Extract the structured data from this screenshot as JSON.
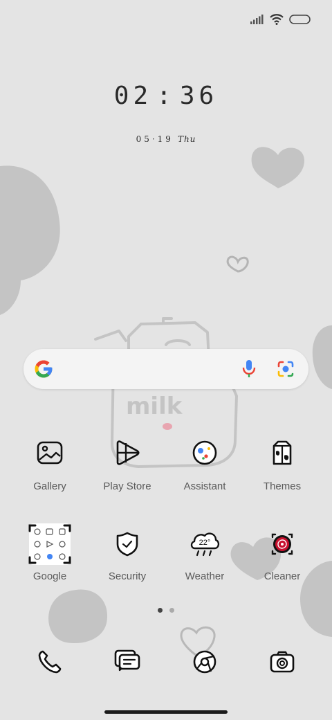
{
  "status_bar": {
    "icons": [
      "signal-icon",
      "wifi-icon",
      "battery-icon"
    ]
  },
  "clock": {
    "hour": "02",
    "minute": "36"
  },
  "date": {
    "month_day": "05·19",
    "weekday": "Thu"
  },
  "wallpaper": {
    "text": "milk"
  },
  "search": {
    "icons": [
      "google-g-icon",
      "microphone-icon",
      "lens-camera-icon"
    ]
  },
  "apps": [
    {
      "label": "Gallery",
      "icon": "gallery-icon"
    },
    {
      "label": "Play Store",
      "icon": "play-store-icon"
    },
    {
      "label": "Assistant",
      "icon": "assistant-icon"
    },
    {
      "label": "Themes",
      "icon": "themes-icon"
    },
    {
      "label": "Google",
      "icon": "google-folder-icon"
    },
    {
      "label": "Security",
      "icon": "security-icon"
    },
    {
      "label": "Weather",
      "icon": "weather-icon",
      "badge": "22°"
    },
    {
      "label": "Cleaner",
      "icon": "cleaner-icon"
    }
  ],
  "page_indicator": {
    "pages": 2,
    "current": 1
  },
  "dock": [
    {
      "icon": "phone-icon"
    },
    {
      "icon": "messages-icon"
    },
    {
      "icon": "browser-icon"
    },
    {
      "icon": "camera-icon"
    }
  ],
  "colors": {
    "background": "#e4e4e4",
    "blob": "#c4c4c4",
    "google_blue": "#4285F4",
    "google_red": "#EA4335",
    "google_yellow": "#FBBC05",
    "google_green": "#34A853",
    "cleaner_red": "#c8102e"
  }
}
